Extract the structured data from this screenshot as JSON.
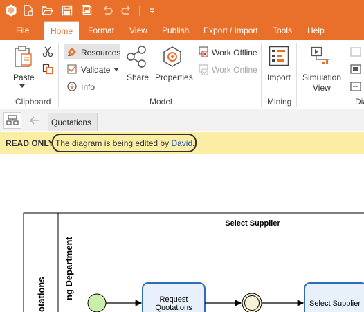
{
  "window": {
    "quick_access": [
      "app-logo-icon",
      "new-document-icon",
      "open-folder-icon",
      "save-icon",
      "save-all-icon",
      "undo-icon",
      "redo-icon",
      "customize-quick-access-icon"
    ]
  },
  "menu": {
    "tabs": [
      "File",
      "Home",
      "Format",
      "View",
      "Publish",
      "Export / Import",
      "Tools",
      "Help"
    ],
    "active": "Home"
  },
  "ribbon": {
    "clipboard": {
      "paste": "Paste",
      "group": "Clipboard"
    },
    "model": {
      "resources": "Resources",
      "validate": "Validate",
      "info": "Info",
      "share": "Share",
      "properties": "Properties",
      "work_offline": "Work Offline",
      "work_online": "Work Online",
      "group": "Model"
    },
    "mining": {
      "import": "Import",
      "group": "Mining"
    },
    "diagram": {
      "simulation_line1": "Simulation",
      "simulation_line2": "View",
      "group_partial": "Dia"
    }
  },
  "doc_tabs": {
    "active_tab": "Quotations"
  },
  "banner": {
    "read_only": "READ ONLY",
    "message": "The diagram is being edited by ",
    "editor": "David",
    "suffix": "."
  },
  "diagram": {
    "lane_title": "Select Supplier",
    "pool_label": "otations",
    "lane_label": "ng Department",
    "task1_line1": "Request",
    "task1_line2": "Quotations",
    "task2": "Select Supplier"
  },
  "colors": {
    "accent": "#e8702a",
    "banner": "#fbeda3",
    "task_fill": "#e8f0fb",
    "task_stroke": "#2f6db3",
    "start_event": "#c8f0a8",
    "intermediate_event": "#f8f2d8"
  }
}
